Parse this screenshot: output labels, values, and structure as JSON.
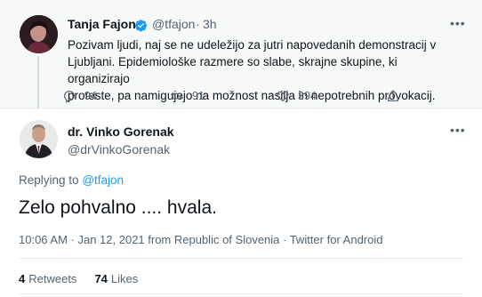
{
  "tweet_parent": {
    "author_name": "Tanja Fajon",
    "handle": "@tfajon",
    "time": "3h",
    "text_lines": [
      "Pozivam ljudi, naj se ne udeležijo za jutri napovedanih demonstracij v",
      "Ljubljani. Epidemiološke razmere so slabe, skrajne skupine, ki organizirajo",
      "proteste, pa namigujejo na možnost nasilja in nepotrebnih provokacij."
    ],
    "replies": "94",
    "retweets": "91",
    "likes": "394",
    "more_label": "•••"
  },
  "tweet_main": {
    "author_name": "dr. Vinko Gorenak",
    "handle": "@drVinkoGorenak",
    "more_label": "•••",
    "replying_prefix": "Replying to",
    "replying_to": "@tfajon",
    "text": "Zelo pohvalno .... hvala.",
    "meta": "10:06 AM · Jan 12, 2021 from Republic of Slovenia · Twitter for Android",
    "retweets_count": "4",
    "retweets_label": "Retweets",
    "likes_count": "74",
    "likes_label": "Likes"
  },
  "colors": {
    "accent": "#1d9bf0",
    "secondary_text": "#536471",
    "primary_text": "#0f1419",
    "parent_bg": "#f7f9f9"
  }
}
